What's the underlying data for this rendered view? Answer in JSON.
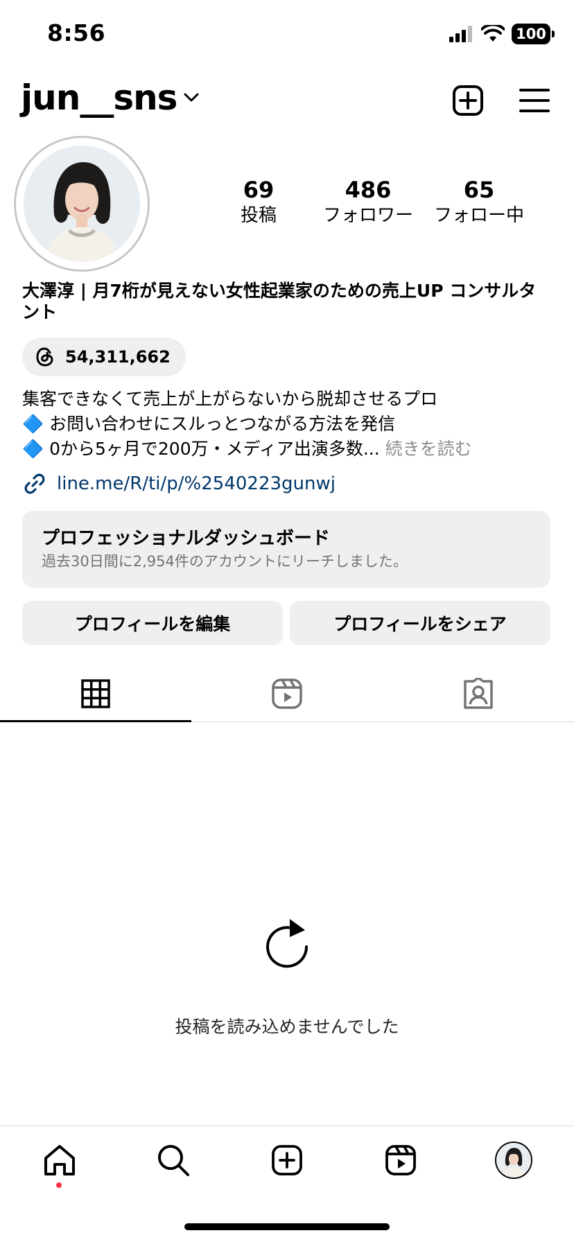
{
  "status_bar": {
    "time": "8:56",
    "battery": "100"
  },
  "header": {
    "username": "jun__sns"
  },
  "stats": [
    {
      "value": "69",
      "label": "投稿"
    },
    {
      "value": "486",
      "label": "フォロワー"
    },
    {
      "value": "65",
      "label": "フォロー中"
    }
  ],
  "profile": {
    "full_name": "大澤淳 | 月7桁が見えない女性起業家のための売上UP コンサルタント",
    "threads_count": "54,311,662",
    "bio_lines": [
      "集客できなくて売上が上がらないから脱却させるプロ",
      "🔷 お問い合わせにスルっとつながる方法を発信",
      "🔷 0から5ヶ月で200万・メディア出演多数..."
    ],
    "more_label": "続きを読む",
    "link": "line.me/R/ti/p/%2540223gunwj"
  },
  "dashboard": {
    "title": "プロフェッショナルダッシュボード",
    "subtitle": "過去30日間に2,954件のアカウントにリーチしました。"
  },
  "buttons": {
    "edit": "プロフィールを編集",
    "share": "プロフィールをシェア"
  },
  "empty_state": {
    "message": "投稿を読み込めませんでした"
  },
  "icons": {
    "header": [
      "create-post-icon",
      "menu-icon"
    ],
    "tabs": [
      "grid-icon",
      "reels-icon",
      "tagged-icon"
    ],
    "nav": [
      "home-icon",
      "search-icon",
      "create-icon",
      "reels-icon",
      "profile-avatar"
    ]
  },
  "colors": {
    "link": "#00376b",
    "notification": "#ff3040",
    "muted": "#8e8e8e"
  }
}
